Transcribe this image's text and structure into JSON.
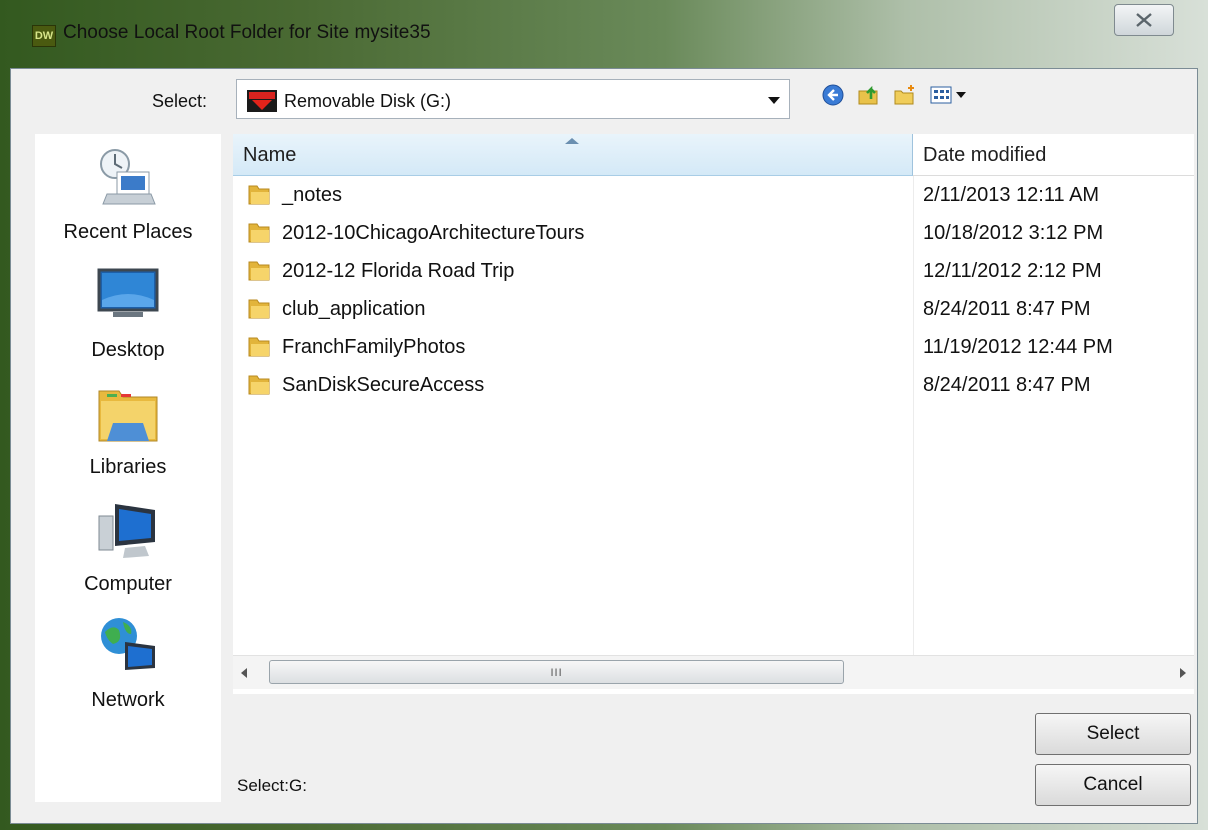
{
  "window": {
    "app_icon_text": "DW",
    "title": "Choose Local Root Folder for Site mysite35"
  },
  "toolbar": {
    "select_label": "Select:",
    "drive": "Removable Disk (G:)",
    "icons": [
      "back-icon",
      "up-folder-icon",
      "new-folder-icon",
      "view-menu-icon"
    ]
  },
  "places": [
    {
      "label": "Recent Places",
      "icon": "recent-places-icon"
    },
    {
      "label": "Desktop",
      "icon": "desktop-icon"
    },
    {
      "label": "Libraries",
      "icon": "libraries-icon"
    },
    {
      "label": "Computer",
      "icon": "computer-icon"
    },
    {
      "label": "Network",
      "icon": "network-icon"
    }
  ],
  "list": {
    "columns": {
      "name": "Name",
      "date": "Date modified"
    },
    "rows": [
      {
        "name": "_notes",
        "date": "2/11/2013 12:11 AM"
      },
      {
        "name": "2012-10ChicagoArchitectureTours",
        "date": "10/18/2012 3:12 PM"
      },
      {
        "name": "2012-12 Florida Road Trip",
        "date": "12/11/2012 2:12 PM"
      },
      {
        "name": "club_application",
        "date": "8/24/2011 8:47 PM"
      },
      {
        "name": "FranchFamilyPhotos",
        "date": "11/19/2012 12:44 PM"
      },
      {
        "name": "SanDiskSecureAccess",
        "date": "8/24/2011 8:47 PM"
      }
    ],
    "scroll_grip": "III"
  },
  "buttons": {
    "select": "Select",
    "cancel": "Cancel"
  },
  "status": {
    "text": "Select:G:"
  }
}
